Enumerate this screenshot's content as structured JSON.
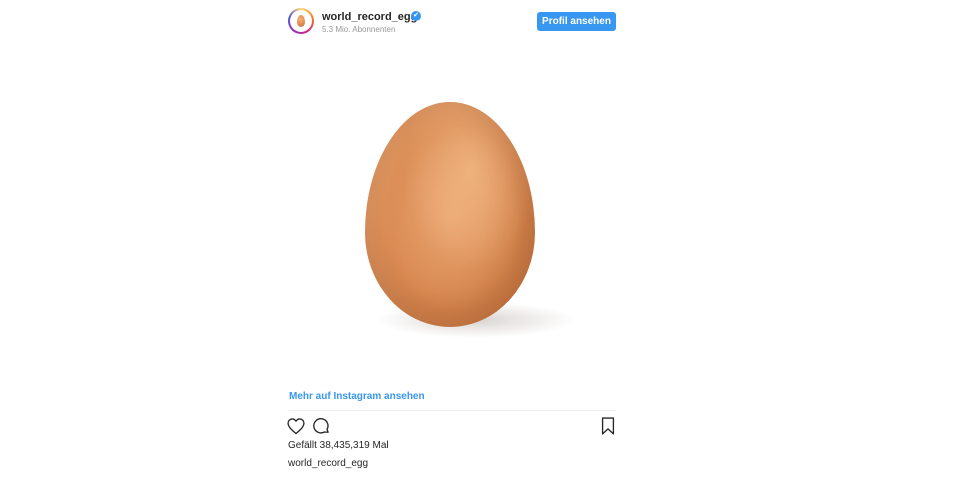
{
  "post": {
    "username": "world_record_egg",
    "followers": "5.3 Mio. Abonnenten",
    "profile_button": "Profil ansehen",
    "more_link": "Mehr auf Instagram ansehen",
    "likes": "Gefällt 38,435,319 Mal",
    "caption_user": "world_record_egg",
    "verified_icon": "✔"
  },
  "icons": {
    "like": "heart-icon",
    "comment": "comment-icon",
    "save": "bookmark-icon",
    "verified": "verified-badge-icon"
  },
  "colors": {
    "accent": "#3897f0",
    "text": "#262626",
    "muted": "#999999"
  }
}
